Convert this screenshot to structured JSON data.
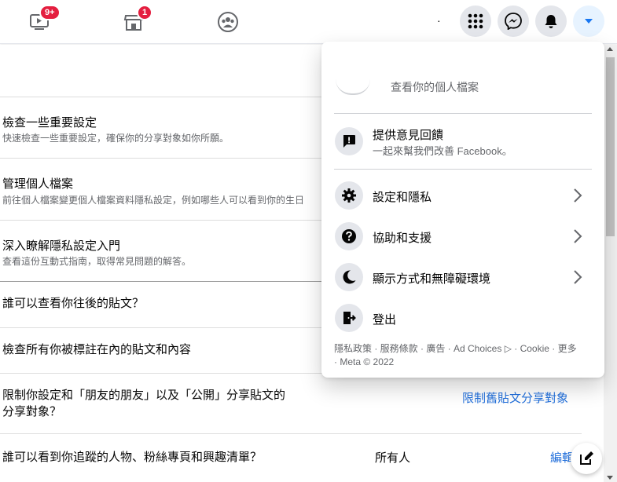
{
  "topbar": {
    "watch_badge": "9+",
    "marketplace_badge": "1",
    "dot": "·"
  },
  "rows": [
    {
      "title": "檢查一些重要設定",
      "subtitle": "快速檢查一些重要設定，確保你的分享對象如你所願。"
    },
    {
      "title": "管理個人檔案",
      "subtitle": "前往個人檔案變更個人檔案資料隱私設定，例如哪些人可以看到你的生日"
    },
    {
      "title": "深入瞭解隱私設定入門",
      "subtitle": "查看這份互動式指南，取得常見問題的解答。"
    }
  ],
  "questions": [
    {
      "text": "誰可以查看你往後的貼文？"
    },
    {
      "text": "檢查所有你被標註在內的貼文和內容"
    },
    {
      "text": "限制你設定和「朋友的朋友」以及「公開」分享貼文的分享對象？",
      "link": "限制舊貼文分享對象"
    },
    {
      "text": "誰可以看到你追蹤的人物、粉絲專頁和興趣清單？",
      "value": "所有人",
      "link": "編輯"
    }
  ],
  "menu": {
    "profile_link": "查看你的個人檔案",
    "feedback_title": "提供意見回饋",
    "feedback_sub": "一起來幫我們改善 Facebook。",
    "items": [
      {
        "label": "設定和隱私",
        "icon": "gear-icon"
      },
      {
        "label": "協助和支援",
        "icon": "question-icon"
      },
      {
        "label": "顯示方式和無障礙環境",
        "icon": "moon-icon"
      },
      {
        "label": "登出",
        "icon": "logout-icon"
      }
    ],
    "footer_line1": "隱私政策 · 服務條款 · 廣告 · Ad Choices ▷ · Cookie · 更多",
    "footer_line2": "· Meta © 2022"
  },
  "colors": {
    "accent": "#216fdb",
    "badge": "#e41e3f"
  }
}
